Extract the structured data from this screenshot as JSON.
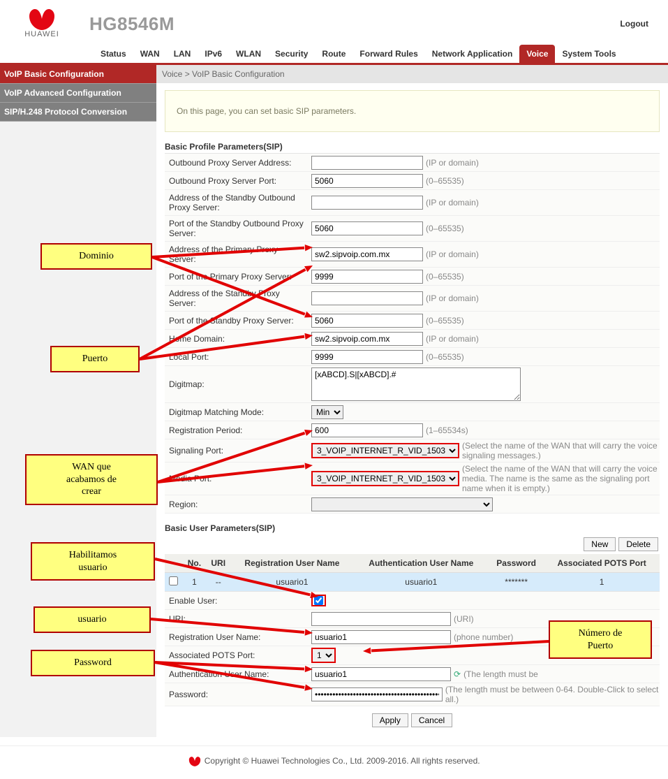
{
  "header": {
    "model": "HG8546M",
    "brand": "HUAWEI",
    "logout": "Logout"
  },
  "nav": {
    "tabs": [
      "Status",
      "WAN",
      "LAN",
      "IPv6",
      "WLAN",
      "Security",
      "Route",
      "Forward Rules",
      "Network Application",
      "Voice",
      "System Tools"
    ],
    "active": 9
  },
  "sidebar": {
    "items": [
      "VoIP Basic Configuration",
      "VoIP Advanced Configuration",
      "SIP/H.248 Protocol Conversion"
    ],
    "active": 0
  },
  "breadcrumb": "Voice > VoIP Basic Configuration",
  "info": "On this page, you can set basic SIP parameters.",
  "section1_title": "Basic Profile Parameters(SIP)",
  "fields": {
    "outbound_addr": {
      "label": "Outbound Proxy Server Address:",
      "value": "",
      "hint": "(IP or domain)"
    },
    "outbound_port": {
      "label": "Outbound Proxy Server Port:",
      "value": "5060",
      "hint": "(0–65535)"
    },
    "standby_out_addr": {
      "label": "Address of the Standby Outbound Proxy Server:",
      "value": "",
      "hint": "(IP or domain)"
    },
    "standby_out_port": {
      "label": "Port of the Standby Outbound Proxy Server:",
      "value": "5060",
      "hint": "(0–65535)"
    },
    "primary_addr": {
      "label": "Address of the Primary Proxy Server:",
      "value": "sw2.sipvoip.com.mx",
      "hint": "(IP or domain)",
      "hl": true
    },
    "primary_port": {
      "label": "Port of the Primary Proxy Server:",
      "value": "9999",
      "hint": "(0–65535)",
      "hl": true
    },
    "standby_addr": {
      "label": "Address of the Standby Proxy Server:",
      "value": "",
      "hint": "(IP or domain)"
    },
    "standby_port": {
      "label": "Port of the Standby Proxy Server:",
      "value": "5060",
      "hint": "(0–65535)"
    },
    "home_domain": {
      "label": "Home Domain:",
      "value": "sw2.sipvoip.com.mx",
      "hint": "(IP or domain)",
      "hl": true
    },
    "local_port": {
      "label": "Local Port:",
      "value": "9999",
      "hint": "(0–65535)",
      "hl": true
    },
    "digitmap": {
      "label": "Digitmap:",
      "value": "[xABCD].S|[xABCD].#"
    },
    "digitmap_mode": {
      "label": "Digitmap Matching Mode:",
      "value": "Min"
    },
    "reg_period": {
      "label": "Registration Period:",
      "value": "600",
      "hint": "(1–65534s)"
    },
    "sig_port": {
      "label": "Signaling Port:",
      "value": "3_VOIP_INTERNET_R_VID_1503",
      "hint": "(Select the name of the WAN that will carry the voice signaling messages.)",
      "hl": true
    },
    "media_port": {
      "label": "Media Port:",
      "value": "3_VOIP_INTERNET_R_VID_1503",
      "hint": "(Select the name of the WAN that will carry the voice media. The name is the same as the signaling port name when it is empty.)",
      "hl": true
    },
    "region": {
      "label": "Region:",
      "value": ""
    }
  },
  "section2_title": "Basic User Parameters(SIP)",
  "btns": {
    "new": "New",
    "delete": "Delete",
    "apply": "Apply",
    "cancel": "Cancel"
  },
  "table": {
    "headers": [
      "",
      "No.",
      "URI",
      "Registration User Name",
      "Authentication User Name",
      "Password",
      "Associated POTS Port"
    ],
    "row": {
      "no": "1",
      "uri": "--",
      "reg": "usuario1",
      "auth": "usuario1",
      "pwd": "*******",
      "pots": "1"
    }
  },
  "user": {
    "enable": {
      "label": "Enable User:",
      "checked": true
    },
    "uri": {
      "label": "URI:",
      "value": "",
      "hint": "(URI)"
    },
    "reg": {
      "label": "Registration User Name:",
      "value": "usuario1",
      "hint": "(phone number)",
      "hl": true
    },
    "pots": {
      "label": "Associated POTS Port:",
      "value": "1",
      "hl": true
    },
    "auth": {
      "label": "Authentication User Name:",
      "value": "usuario1",
      "hint": "(The length must be",
      "hl": true
    },
    "pwd": {
      "label": "Password:",
      "value": "••••••••••••••••••••••••••••••••••••••••••••••••••",
      "hint": "(The length must be between 0-64. Double-Click to select all.)",
      "hl": true
    }
  },
  "footer": "Copyright © Huawei Technologies Co., Ltd. 2009-2016. All rights reserved.",
  "annotations": {
    "dominio": "Dominio",
    "puerto": "Puerto",
    "wan": "WAN que\nacabamos de\ncrear",
    "hab": "Habilitamos\nusuario",
    "usuario": "usuario",
    "password": "Password",
    "numport": "Número de\nPuerto"
  }
}
